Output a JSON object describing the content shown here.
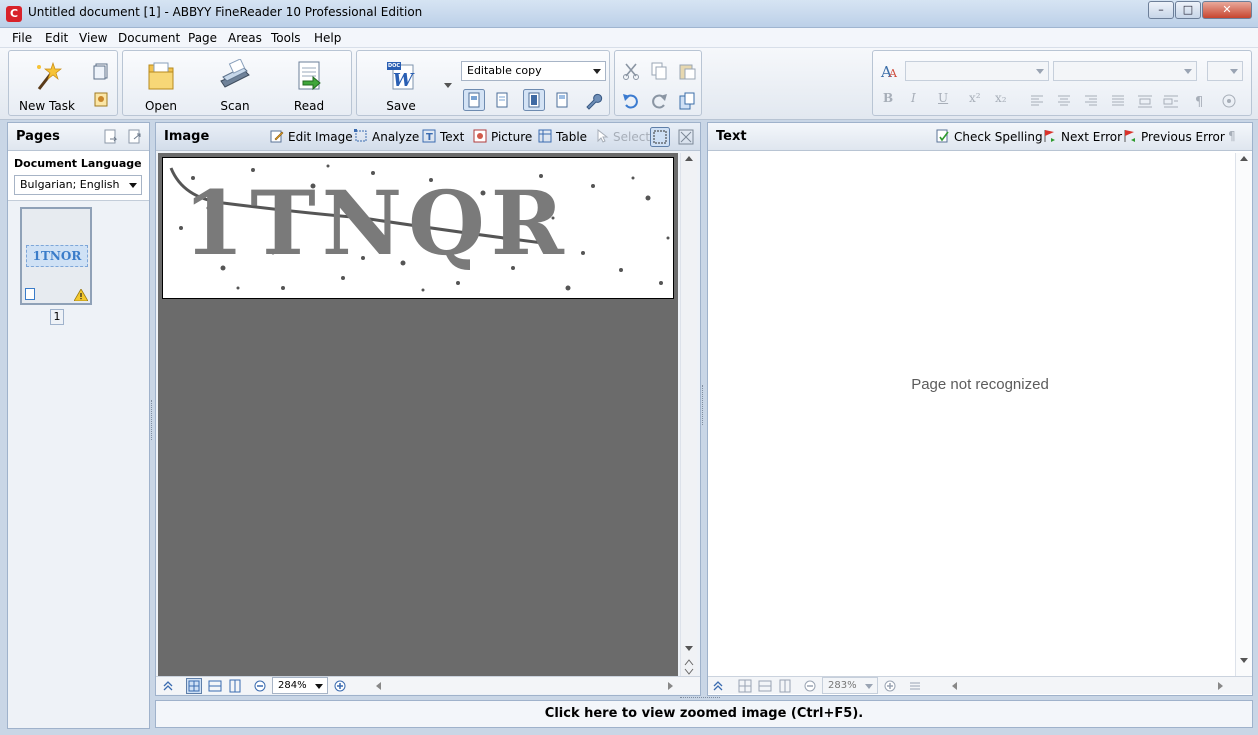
{
  "window": {
    "title": "Untitled document [1] - ABBYY FineReader 10 Professional Edition",
    "app_icon_letter": "C",
    "controls": {
      "minimize": "–",
      "maximize": "□",
      "close": "✕"
    }
  },
  "menu": [
    "File",
    "Edit",
    "View",
    "Document",
    "Page",
    "Areas",
    "Tools",
    "Help"
  ],
  "toolbar": {
    "new_task": "New Task",
    "open": "Open",
    "scan": "Scan",
    "read": "Read",
    "save": "Save",
    "save_format_badge": "DOC",
    "save_mode": "Editable copy"
  },
  "pages_panel": {
    "title": "Pages",
    "doc_language_label": "Document Language",
    "doc_language_value": "Bulgarian; English",
    "thumb_text": "1TNOR",
    "page_number": "1"
  },
  "image_panel": {
    "title": "Image",
    "tools": {
      "edit_image": "Edit Image",
      "analyze": "Analyze",
      "text": "Text",
      "picture": "Picture",
      "table": "Table",
      "select": "Select"
    },
    "captcha_text": "1TNQR",
    "zoom": "284%"
  },
  "text_panel": {
    "title": "Text",
    "check_spelling": "Check Spelling",
    "next_error": "Next Error",
    "previous_error": "Previous Error",
    "pilcrow": "¶",
    "message": "Page not recognized",
    "zoom": "283%"
  },
  "format_buttons": [
    "B",
    "I",
    "U",
    "x²",
    "x₂"
  ],
  "status": {
    "zoom_hint": "Click here to view zoomed image (Ctrl+F5)."
  }
}
